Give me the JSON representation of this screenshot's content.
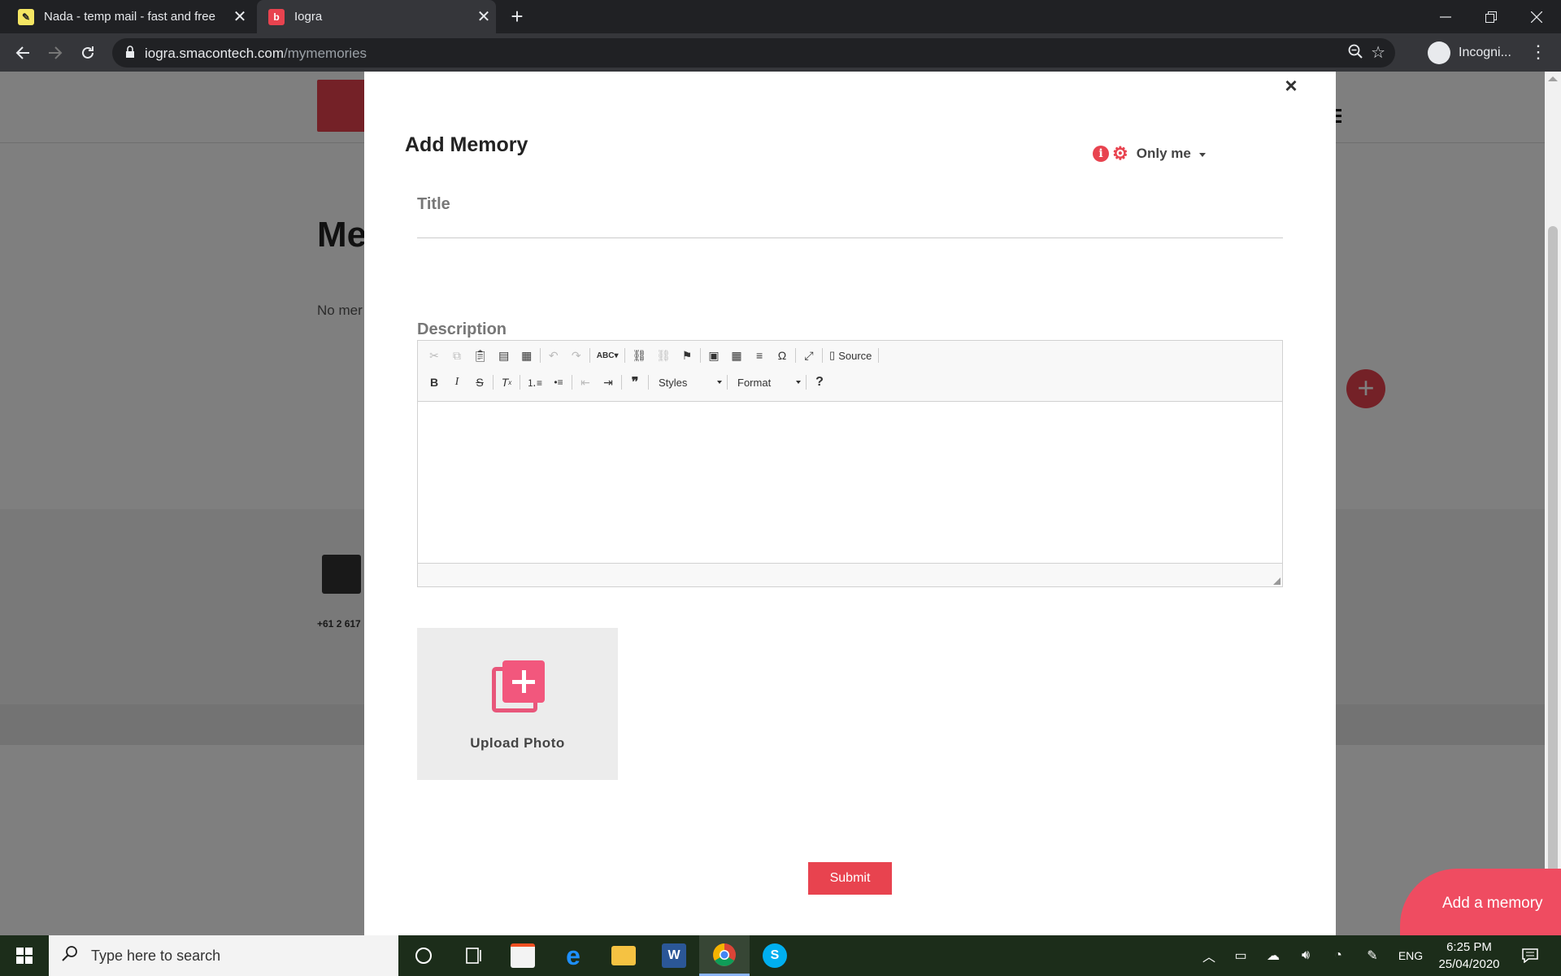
{
  "browser": {
    "tabs": [
      {
        "title": "Nada - temp mail - fast and free",
        "close": "✕"
      },
      {
        "title": "Iogra",
        "close": "✕"
      }
    ],
    "new_tab": "+",
    "url_host": "iogra.smacontech.com",
    "url_path": "/mymemories",
    "profile_label": "Incogni..."
  },
  "page": {
    "heading": "Me",
    "no_memories": "No mer",
    "phone": "+61 2 617"
  },
  "modal": {
    "close": "×",
    "title": "Add Memory",
    "privacy_value": "Only me",
    "title_label": "Title",
    "title_value": "",
    "description_label": "Description",
    "toolbar": {
      "source_label": "Source",
      "styles_label": "Styles",
      "format_label": "Format",
      "help_label": "?"
    },
    "upload_label": "Upload Photo",
    "submit_label": "Submit"
  },
  "floating_button": "Add a memory",
  "taskbar": {
    "search_placeholder": "Type here to search",
    "language": "ENG",
    "time": "6:25 PM",
    "date": "25/04/2020"
  },
  "colors": {
    "accent": "#e8434f",
    "upload_icon": "#f2577d",
    "chrome_dark": "#202124",
    "chrome_toolbar": "#35363a"
  }
}
